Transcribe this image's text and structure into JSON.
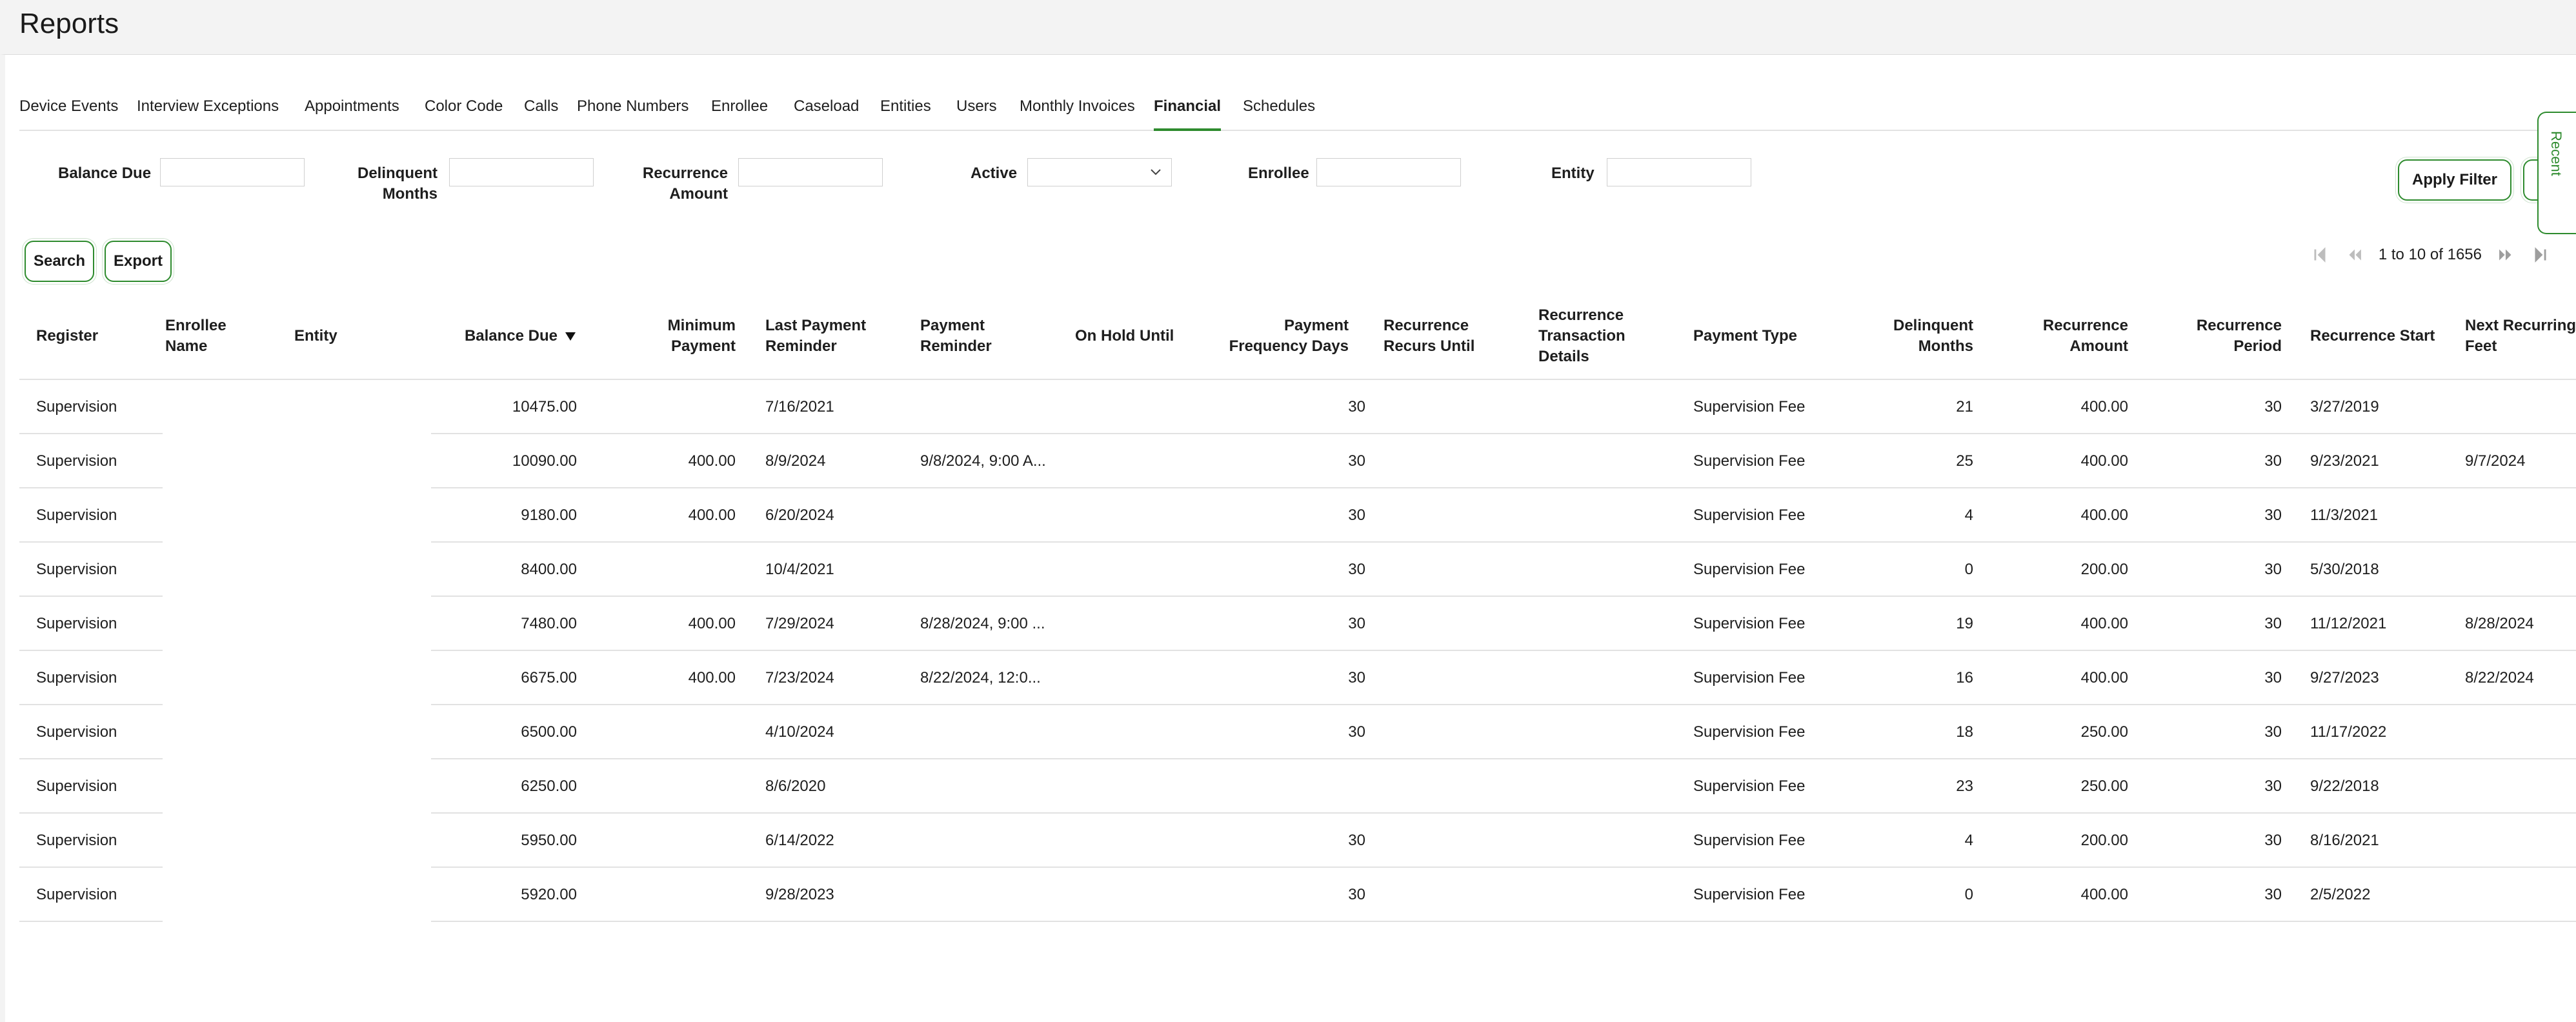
{
  "page": {
    "title": "Reports"
  },
  "tabs": [
    {
      "label": "Device Events"
    },
    {
      "label": "Interview Exceptions"
    },
    {
      "label": "Appointments"
    },
    {
      "label": "Color Code"
    },
    {
      "label": "Calls"
    },
    {
      "label": "Phone Numbers"
    },
    {
      "label": "Enrollee"
    },
    {
      "label": "Caseload"
    },
    {
      "label": "Entities"
    },
    {
      "label": "Users"
    },
    {
      "label": "Monthly Invoices"
    },
    {
      "label": "Financial"
    },
    {
      "label": "Schedules"
    }
  ],
  "active_tab": "Financial",
  "filters": {
    "balance_due": {
      "label": "Balance Due",
      "value": ""
    },
    "delinquent_months": {
      "label_line1": "Delinquent",
      "label_line2": "Months",
      "value": ""
    },
    "recurrence_amount": {
      "label_line1": "Recurrence",
      "label_line2": "Amount",
      "value": ""
    },
    "active": {
      "label": "Active",
      "value": ""
    },
    "enrollee": {
      "label": "Enrollee",
      "value": ""
    },
    "entity": {
      "label": "Entity",
      "value": ""
    }
  },
  "buttons": {
    "apply_filter": "Apply Filter",
    "search": "Search",
    "export": "Export",
    "recent": "Recent"
  },
  "pagination": {
    "text": "1 to 10 of 1656"
  },
  "table": {
    "columns": {
      "register": "Register",
      "enrollee_name": "Enrollee Name",
      "entity": "Entity",
      "balance_due": "Balance Due",
      "minimum_payment": "Minimum Payment",
      "last_payment_reminder": "Last Payment Reminder",
      "payment_reminder": "Payment Reminder",
      "on_hold_until": "On Hold Until",
      "payment_frequency_days": "Payment Frequency Days",
      "recurrence_recurs_until": "Recurrence Recurs Until",
      "recurrence_transaction_details": "Recurrence Transaction Details",
      "payment_type": "Payment Type",
      "delinquent_months": "Delinquent Months",
      "recurrence_amount": "Recurrence Amount",
      "recurrence_period": "Recurrence Period",
      "recurrence_start": "Recurrence Start",
      "next_recurring_fee": "Next Recurring Feet"
    },
    "rows": [
      {
        "register": "Supervision",
        "enrollee_name": "",
        "entity": "",
        "balance_due": "10475.00",
        "minimum_payment": "",
        "last_payment_reminder": "7/16/2021",
        "payment_reminder": "",
        "on_hold_until": "",
        "payment_frequency_days": "30",
        "recurrence_recurs_until": "",
        "recurrence_transaction_details": "",
        "payment_type": "Supervision Fee",
        "delinquent_months": "21",
        "recurrence_amount": "400.00",
        "recurrence_period": "30",
        "recurrence_start": "3/27/2019",
        "next_recurring_fee": ""
      },
      {
        "register": "Supervision",
        "enrollee_name": "",
        "entity": "",
        "balance_due": "10090.00",
        "minimum_payment": "400.00",
        "last_payment_reminder": "8/9/2024",
        "payment_reminder": "9/8/2024, 9:00 A...",
        "on_hold_until": "",
        "payment_frequency_days": "30",
        "recurrence_recurs_until": "",
        "recurrence_transaction_details": "",
        "payment_type": "Supervision Fee",
        "delinquent_months": "25",
        "recurrence_amount": "400.00",
        "recurrence_period": "30",
        "recurrence_start": "9/23/2021",
        "next_recurring_fee": "9/7/2024"
      },
      {
        "register": "Supervision",
        "enrollee_name": "",
        "entity": "",
        "balance_due": "9180.00",
        "minimum_payment": "400.00",
        "last_payment_reminder": "6/20/2024",
        "payment_reminder": "",
        "on_hold_until": "",
        "payment_frequency_days": "30",
        "recurrence_recurs_until": "",
        "recurrence_transaction_details": "",
        "payment_type": "Supervision Fee",
        "delinquent_months": "4",
        "recurrence_amount": "400.00",
        "recurrence_period": "30",
        "recurrence_start": "11/3/2021",
        "next_recurring_fee": ""
      },
      {
        "register": "Supervision",
        "enrollee_name": "",
        "entity": "",
        "balance_due": "8400.00",
        "minimum_payment": "",
        "last_payment_reminder": "10/4/2021",
        "payment_reminder": "",
        "on_hold_until": "",
        "payment_frequency_days": "30",
        "recurrence_recurs_until": "",
        "recurrence_transaction_details": "",
        "payment_type": "Supervision Fee",
        "delinquent_months": "0",
        "recurrence_amount": "200.00",
        "recurrence_period": "30",
        "recurrence_start": "5/30/2018",
        "next_recurring_fee": ""
      },
      {
        "register": "Supervision",
        "enrollee_name": "",
        "entity": "",
        "balance_due": "7480.00",
        "minimum_payment": "400.00",
        "last_payment_reminder": "7/29/2024",
        "payment_reminder": "8/28/2024, 9:00 ...",
        "on_hold_until": "",
        "payment_frequency_days": "30",
        "recurrence_recurs_until": "",
        "recurrence_transaction_details": "",
        "payment_type": "Supervision Fee",
        "delinquent_months": "19",
        "recurrence_amount": "400.00",
        "recurrence_period": "30",
        "recurrence_start": "11/12/2021",
        "next_recurring_fee": "8/28/2024"
      },
      {
        "register": "Supervision",
        "enrollee_name": "",
        "entity": "",
        "balance_due": "6675.00",
        "minimum_payment": "400.00",
        "last_payment_reminder": "7/23/2024",
        "payment_reminder": "8/22/2024, 12:0...",
        "on_hold_until": "",
        "payment_frequency_days": "30",
        "recurrence_recurs_until": "",
        "recurrence_transaction_details": "",
        "payment_type": "Supervision Fee",
        "delinquent_months": "16",
        "recurrence_amount": "400.00",
        "recurrence_period": "30",
        "recurrence_start": "9/27/2023",
        "next_recurring_fee": "8/22/2024"
      },
      {
        "register": "Supervision",
        "enrollee_name": "",
        "entity": "",
        "balance_due": "6500.00",
        "minimum_payment": "",
        "last_payment_reminder": "4/10/2024",
        "payment_reminder": "",
        "on_hold_until": "",
        "payment_frequency_days": "30",
        "recurrence_recurs_until": "",
        "recurrence_transaction_details": "",
        "payment_type": "Supervision Fee",
        "delinquent_months": "18",
        "recurrence_amount": "250.00",
        "recurrence_period": "30",
        "recurrence_start": "11/17/2022",
        "next_recurring_fee": ""
      },
      {
        "register": "Supervision",
        "enrollee_name": "",
        "entity": "",
        "balance_due": "6250.00",
        "minimum_payment": "",
        "last_payment_reminder": "8/6/2020",
        "payment_reminder": "",
        "on_hold_until": "",
        "payment_frequency_days": "",
        "recurrence_recurs_until": "",
        "recurrence_transaction_details": "",
        "payment_type": "Supervision Fee",
        "delinquent_months": "23",
        "recurrence_amount": "250.00",
        "recurrence_period": "30",
        "recurrence_start": "9/22/2018",
        "next_recurring_fee": ""
      },
      {
        "register": "Supervision",
        "enrollee_name": "",
        "entity": "",
        "balance_due": "5950.00",
        "minimum_payment": "",
        "last_payment_reminder": "6/14/2022",
        "payment_reminder": "",
        "on_hold_until": "",
        "payment_frequency_days": "30",
        "recurrence_recurs_until": "",
        "recurrence_transaction_details": "",
        "payment_type": "Supervision Fee",
        "delinquent_months": "4",
        "recurrence_amount": "200.00",
        "recurrence_period": "30",
        "recurrence_start": "8/16/2021",
        "next_recurring_fee": ""
      },
      {
        "register": "Supervision",
        "enrollee_name": "",
        "entity": "",
        "balance_due": "5920.00",
        "minimum_payment": "",
        "last_payment_reminder": "9/28/2023",
        "payment_reminder": "",
        "on_hold_until": "",
        "payment_frequency_days": "30",
        "recurrence_recurs_until": "",
        "recurrence_transaction_details": "",
        "payment_type": "Supervision Fee",
        "delinquent_months": "0",
        "recurrence_amount": "400.00",
        "recurrence_period": "30",
        "recurrence_start": "2/5/2022",
        "next_recurring_fee": ""
      }
    ]
  },
  "colors": {
    "accent": "#2e8b2e",
    "border": "#e2e2e2",
    "header_bg": "#f3f3f3"
  },
  "icons": {
    "sort": "sort-descending-icon",
    "select": "chevron-down-icon",
    "first": "first-page-icon",
    "prev": "previous-page-icon",
    "next": "next-page-icon",
    "last": "last-page-icon"
  }
}
